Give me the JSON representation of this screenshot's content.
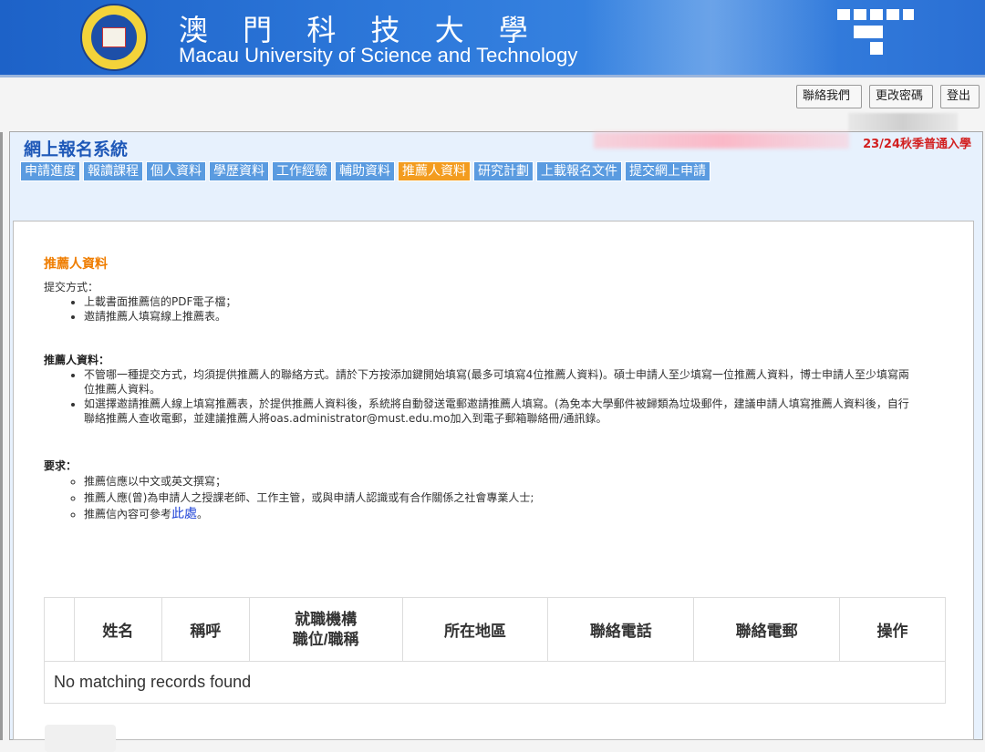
{
  "header": {
    "title_zh": "澳 門 科 技 大 學",
    "title_en": "Macau University of Science and Technology"
  },
  "toolbar": {
    "contact": "聯絡我們",
    "change_password": "更改密碼",
    "logout": "登出"
  },
  "app": {
    "system_title": "網上報名系統",
    "term": "23/24秋季普通入學",
    "tabs": [
      {
        "label": "申請進度",
        "active": false
      },
      {
        "label": "報讀課程",
        "active": false
      },
      {
        "label": "個人資料",
        "active": false
      },
      {
        "label": "學歷資料",
        "active": false
      },
      {
        "label": "工作經驗",
        "active": false
      },
      {
        "label": "輔助資料",
        "active": false
      },
      {
        "label": "推薦人資料",
        "active": true
      },
      {
        "label": "研究計劃",
        "active": false
      },
      {
        "label": "上載報名文件",
        "active": false
      },
      {
        "label": "提交網上申請",
        "active": false
      }
    ]
  },
  "content": {
    "title": "推薦人資料",
    "submit_label": "提交方式：",
    "submit_items": [
      "上載書面推薦信的PDF電子檔；",
      "邀請推薦人填寫線上推薦表。"
    ],
    "referee_label": "推薦人資料：",
    "referee_items": [
      "不管哪一種提交方式，均須提供推薦人的聯絡方式。請於下方按添加鍵開始填寫(最多可填寫4位推薦人資料)。碩士申請人至少填寫一位推薦人資料，博士申請人至少填寫兩位推薦人資料。",
      "如選擇邀請推薦人線上填寫推薦表，於提供推薦人資料後，系統將自動發送電郵邀請推薦人填寫。(為免本大學郵件被歸類為垃圾郵件，建議申請人填寫推薦人資料後，自行聯絡推薦人查收電郵，並建議推薦人將oas.administrator@must.edu.mo加入到電子郵箱聯絡冊/通訊錄。"
    ],
    "req_label": "要求：",
    "req_items": [
      "推薦信應以中文或英文撰寫；",
      "推薦人應(曾)為申請人之授課老師、工作主管，或與申請人認識或有合作關係之社會專業人士;"
    ],
    "req_last_prefix": "推薦信內容可參考",
    "req_last_link": "此處",
    "req_last_suffix": "。"
  },
  "table": {
    "headers": [
      "姓名",
      "稱呼",
      "就職機構",
      "職位/職稱",
      "所在地區",
      "聯絡電話",
      "聯絡電郵",
      "操作"
    ],
    "empty_message": "No matching records found"
  },
  "colors": {
    "banner": "#2d78da",
    "tab": "#5a9be0",
    "tab_active": "#f39c1f",
    "title_orange": "#ef7d00",
    "term_red": "#d22020"
  }
}
